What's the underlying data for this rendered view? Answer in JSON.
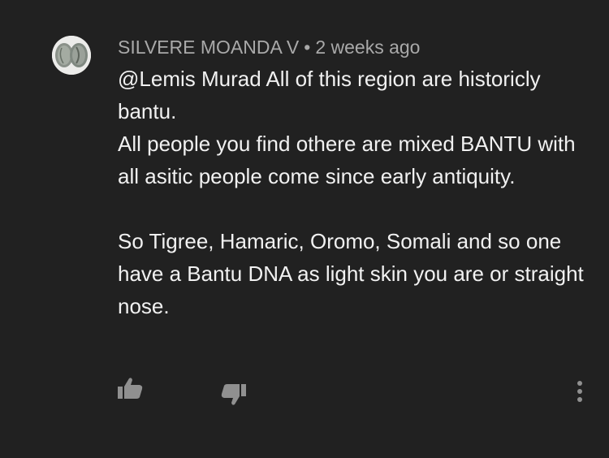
{
  "comment": {
    "author": "SILVERE MOANDA V",
    "separator": "•",
    "timestamp": "2 weeks ago",
    "lines": [
      "@Lemis Murad All of this region are historicly bantu.",
      "All people you find othere are mixed BANTU with all asitic people come since early antiquity.",
      "",
      "So Tigree, Hamaric, Oromo, Somali and so one have a Bantu DNA as light skin you are or straight nose."
    ]
  },
  "actions": {
    "like_icon": "thumbs-up-icon",
    "dislike_icon": "thumbs-down-icon",
    "more_icon": "more-vertical-icon"
  },
  "colors": {
    "background": "#212121",
    "text": "#f1f1f1",
    "meta": "#a9a9a9",
    "icon": "#909090"
  }
}
